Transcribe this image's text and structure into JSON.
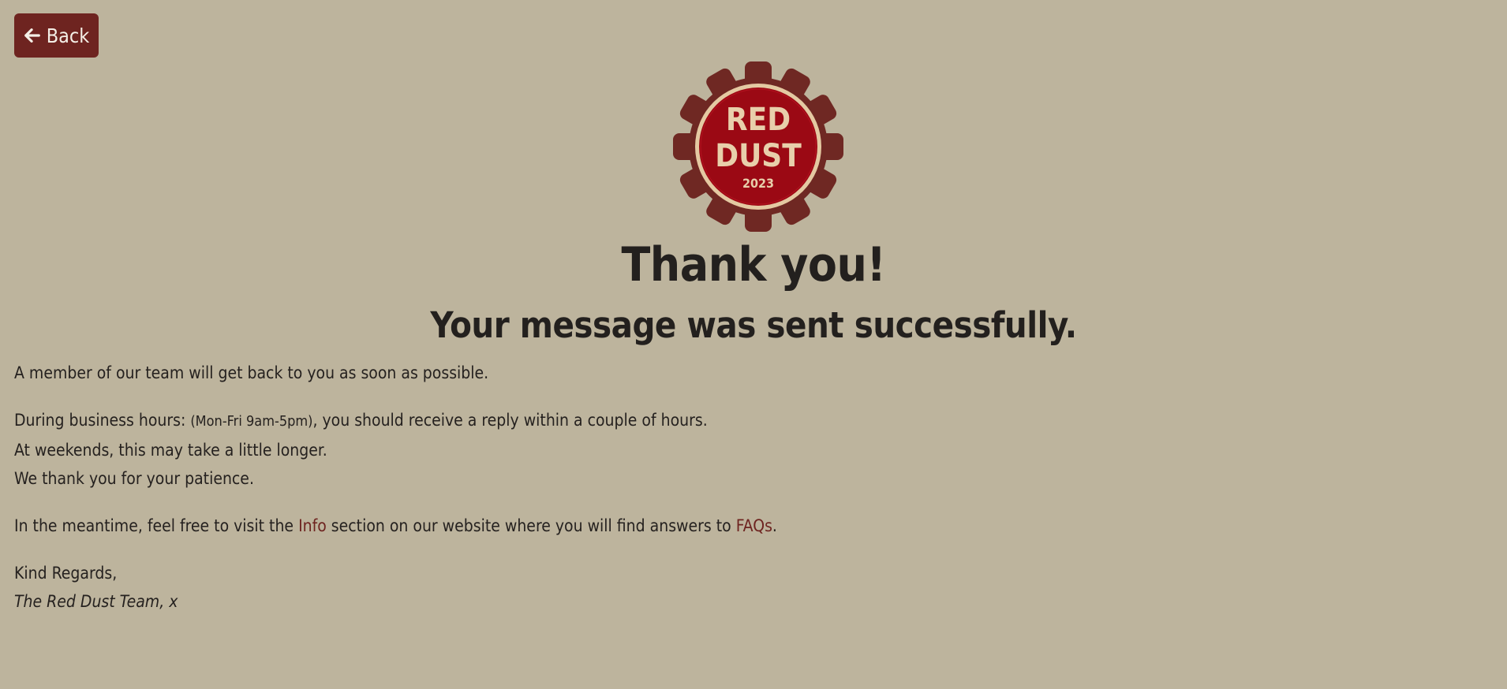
{
  "back_button": {
    "label": "Back",
    "icon": "arrow-left-icon"
  },
  "logo": {
    "text_line1": "RED",
    "text_line2": "DUST",
    "year": "2023",
    "gear_color": "#6f2823",
    "badge_color": "#9b0914",
    "text_color": "#e8cfab"
  },
  "heading": {
    "title": "Thank you!",
    "subtitle": "Your message was sent successfully."
  },
  "message": {
    "line1": "A member of our team will get back to you as soon as possible.",
    "business_prefix": "During business hours: ",
    "business_hours": "(Mon-Fri 9am-5pm)",
    "business_suffix": ", you should receive a reply within a couple of hours.",
    "weekends": "At weekends, this may take a little longer.",
    "patience": "We thank you for your patience.",
    "meantime_prefix": "In the meantime, feel free to visit the ",
    "info_link": "Info",
    "meantime_middle": " section on our website where you will find answers to ",
    "faq_link": "FAQs",
    "meantime_suffix": ".",
    "regards": "Kind Regards,",
    "signature": "The Red Dust Team, x"
  },
  "colors": {
    "background": "#bdb49d",
    "accent": "#6e2420",
    "text": "#23201e"
  }
}
